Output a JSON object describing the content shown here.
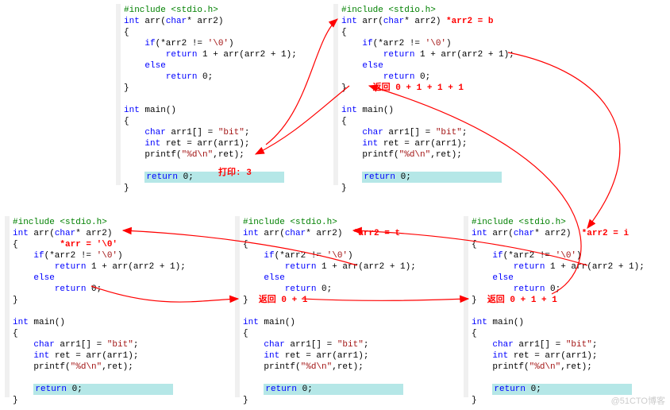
{
  "blocks": {
    "b1": {
      "include": "#include <stdio.h>",
      "fn": "int arr(char* arr2)",
      "ob": "{",
      "if": "    if(*arr2 != '\\0')",
      "ret1": "        return 1 + arr(arr2 + 1);",
      "else": "    else",
      "ret0": "        return 0;",
      "cb": "}",
      "main": "int main()",
      "mob": "{",
      "decl1": "    char arr1[] = ",
      "decl1s": "\"bit\"",
      "decl1e": ";",
      "decl2": "    int ret = arr(arr1);",
      "printf1": "    printf(",
      "printf2": "\"%d\\n\"",
      "printf3": ",ret);",
      "ret": "return 0;",
      "mcb": "}",
      "note": "打印: 3"
    },
    "b2": {
      "note_fn": "*arr2 = b",
      "note_ret": "返回 0 + 1 + 1 + 1"
    },
    "b3": {
      "note_fn": "*arr = '\\0'"
    },
    "b4": {
      "note_fn": "*arr2 = t",
      "note_ret": "返回 0 + 1"
    },
    "b5": {
      "note_fn": "*arr2 = i",
      "note_ret": "返回 0 + 1 + 1"
    }
  },
  "watermark": "@51CTO博客"
}
